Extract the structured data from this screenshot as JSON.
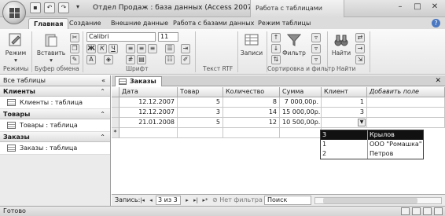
{
  "window": {
    "title": "Отдел Продаж : база данных (Access 2007) - M...",
    "context_tab_title": "Работа с таблицами",
    "minimize": "–",
    "maximize": "□",
    "close": "✕"
  },
  "ribbon": {
    "tabs": [
      "Главная",
      "Создание",
      "Внешние данные",
      "Работа с базами данных",
      "Режим таблицы"
    ],
    "buttons": {
      "view": "Режим",
      "paste": "Вставить",
      "records": "Записи",
      "filter": "Фильтр",
      "find": "Найти"
    },
    "font_name": "Calibri",
    "font_size": "11",
    "groups": [
      "Режимы",
      "Буфер обмена",
      "Шрифт",
      "Текст RTF",
      "Сортировка и фильтр",
      "Найти"
    ]
  },
  "nav": {
    "header": "Все таблицы",
    "sections": [
      {
        "title": "Клиенты",
        "items": [
          "Клиенты : таблица"
        ]
      },
      {
        "title": "Товары",
        "items": [
          "Товары : таблица"
        ]
      },
      {
        "title": "Заказы",
        "items": [
          "Заказы : таблица"
        ]
      }
    ]
  },
  "document": {
    "tab": "Заказы",
    "columns": [
      "Дата",
      "Товар",
      "Количество",
      "Сумма",
      "Клиент",
      "Добавить поле"
    ],
    "rows": [
      [
        "12.12.2007",
        "5",
        "8",
        "7 000,00р.",
        "1"
      ],
      [
        "12.12.2007",
        "3",
        "14",
        "15 000,00р.",
        "3"
      ],
      [
        "21.01.2008",
        "5",
        "12",
        "10 500,00р.",
        ""
      ]
    ],
    "new_row_marker": "*",
    "combo_options": [
      {
        "id": "3",
        "name": "Крылов",
        "selected": true
      },
      {
        "id": "1",
        "name": "ООО \"Ромашка\"",
        "selected": false
      },
      {
        "id": "2",
        "name": "Петров",
        "selected": false
      }
    ]
  },
  "record_nav": {
    "label": "Запись:",
    "position": "3 из 3",
    "filter": "Нет фильтра",
    "search": "Поиск"
  },
  "status": {
    "text": "Готово"
  }
}
